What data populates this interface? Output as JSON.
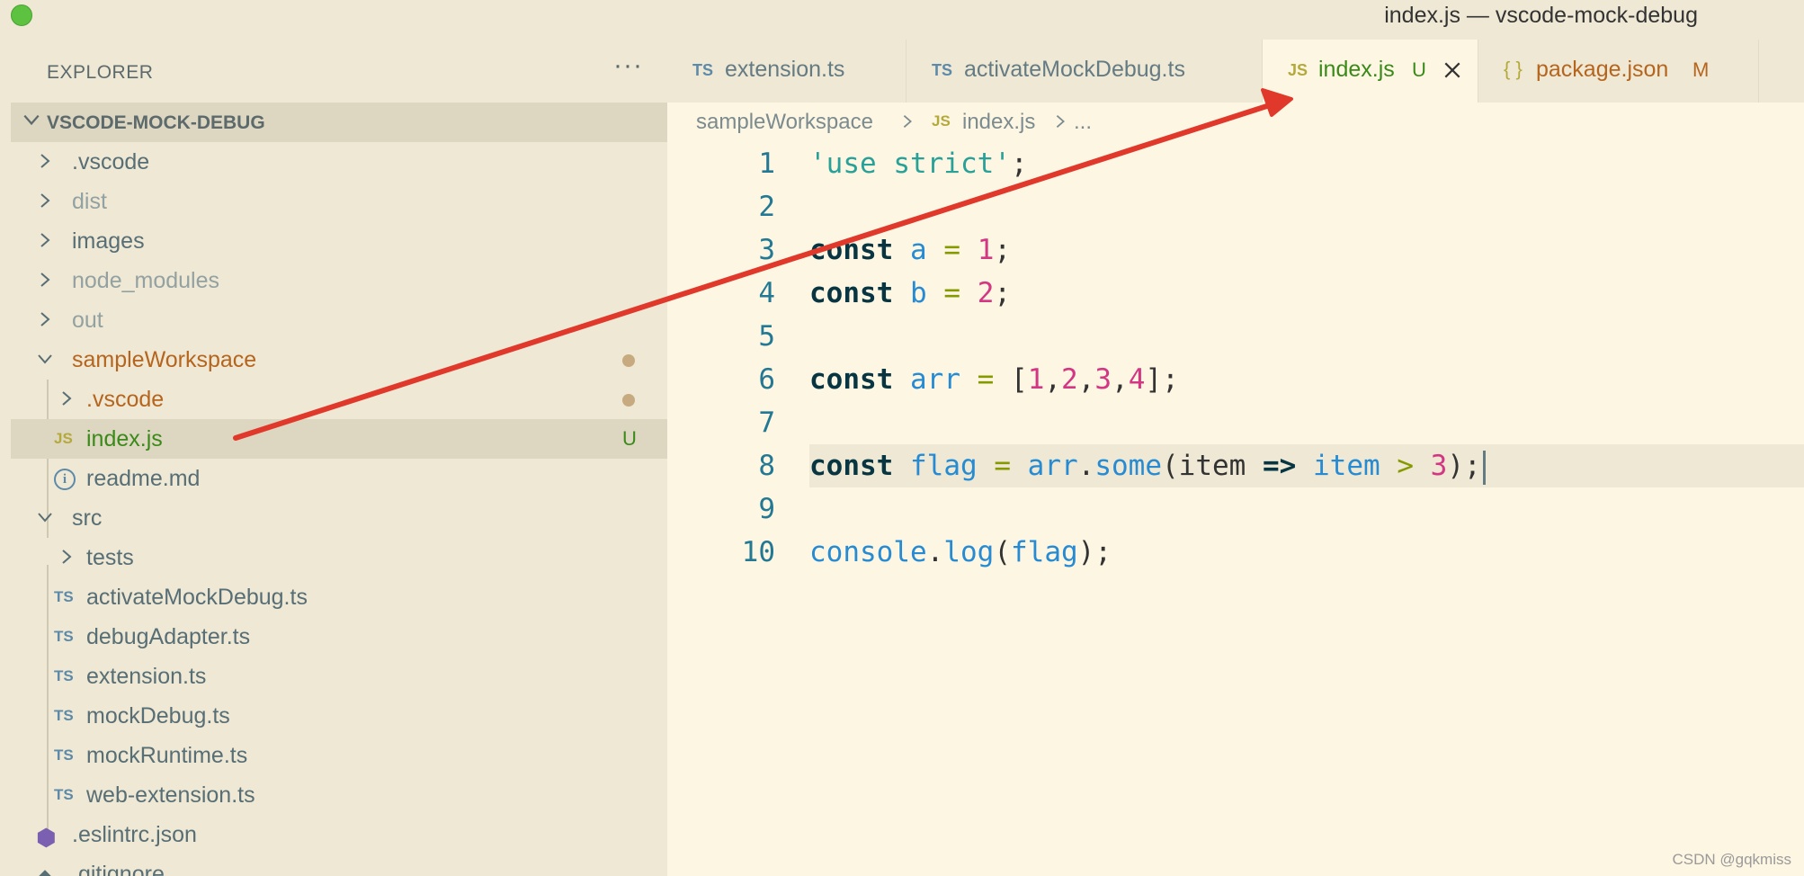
{
  "window": {
    "title": "index.js — vscode-mock-debug"
  },
  "sidebar": {
    "header": "EXPLORER",
    "more_icon": "···",
    "root": "VSCODE-MOCK-DEBUG",
    "items": [
      {
        "label": ".vscode",
        "kind": "folder"
      },
      {
        "label": "dist",
        "kind": "folder"
      },
      {
        "label": "images",
        "kind": "folder"
      },
      {
        "label": "node_modules",
        "kind": "folder"
      },
      {
        "label": "out",
        "kind": "folder"
      },
      {
        "label": "sampleWorkspace",
        "kind": "folder"
      },
      {
        "label": ".vscode",
        "kind": "folder"
      },
      {
        "label": "index.js",
        "kind": "file",
        "icon": "JS",
        "badge": "U"
      },
      {
        "label": "readme.md",
        "kind": "file"
      },
      {
        "label": "src",
        "kind": "folder"
      },
      {
        "label": "tests",
        "kind": "folder"
      },
      {
        "label": "activateMockDebug.ts",
        "kind": "file",
        "icon": "TS"
      },
      {
        "label": "debugAdapter.ts",
        "kind": "file",
        "icon": "TS"
      },
      {
        "label": "extension.ts",
        "kind": "file",
        "icon": "TS"
      },
      {
        "label": "mockDebug.ts",
        "kind": "file",
        "icon": "TS"
      },
      {
        "label": "mockRuntime.ts",
        "kind": "file",
        "icon": "TS"
      },
      {
        "label": "web-extension.ts",
        "kind": "file",
        "icon": "TS"
      },
      {
        "label": ".eslintrc.json",
        "kind": "file"
      },
      {
        "label": ".gitignore",
        "kind": "file"
      }
    ]
  },
  "tabs": [
    {
      "icon": "TS",
      "label": "extension.ts"
    },
    {
      "icon": "TS",
      "label": "activateMockDebug.ts"
    },
    {
      "icon": "JS",
      "label": "index.js",
      "badge": "U",
      "active": true
    },
    {
      "icon": "{ }",
      "label": "package.json",
      "badge": "M"
    }
  ],
  "breadcrumb": {
    "folder": "sampleWorkspace",
    "file_icon": "JS",
    "file": "index.js",
    "ellipsis": "..."
  },
  "editor": {
    "line_numbers": [
      "1",
      "2",
      "3",
      "4",
      "5",
      "6",
      "7",
      "8",
      "9",
      "10"
    ],
    "code": [
      "'use strict';",
      "",
      "const a = 1;",
      "const b = 2;",
      "",
      "const arr = [1,2,3,4];",
      "",
      "const flag = arr.some(item => item > 3);",
      "",
      "console.log(flag);"
    ]
  },
  "watermark": "CSDN @gqkmiss",
  "colors": {
    "background": "#fdf6e3",
    "sidebar": "#eee8d5",
    "selection": "#ddd6c1",
    "untracked": "#3a8a1a",
    "modified": "#b5651d",
    "arrow": "#e0392b"
  }
}
